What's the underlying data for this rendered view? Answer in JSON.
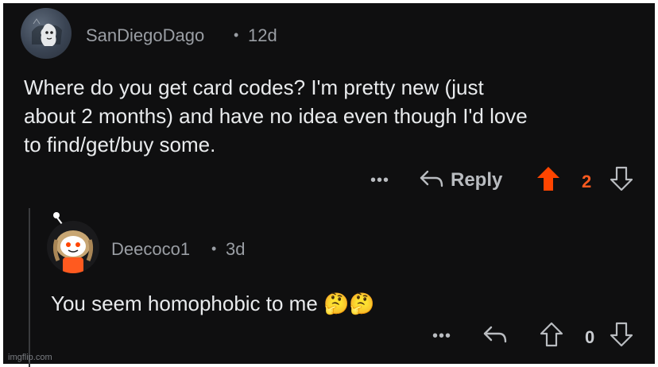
{
  "comments": [
    {
      "username": "SanDiegoDago",
      "separator": "•",
      "age": "12d",
      "text": "Where do you get card codes? I'm pretty new (just\nabout 2 months) and have no idea even though I'd love\nto find/get/buy some.",
      "actions": {
        "more": "•••",
        "reply_label": "Reply",
        "score": "2",
        "upvoted": true
      }
    },
    {
      "username": "Deecoco1",
      "separator": "•",
      "age": "3d",
      "text": "You seem homophobic to me 🤔🤔",
      "actions": {
        "more": "•••",
        "score": "0",
        "upvoted": false
      }
    }
  ],
  "watermark": "imgflip.com",
  "colors": {
    "upvote_active": "#ff4500",
    "score_active": "#ff5a1f",
    "text": "#e9ebed",
    "muted": "#9a9ea4"
  },
  "icons": [
    "avatar-ghost-icon",
    "reply-arrow-icon",
    "upvote-arrow-icon",
    "downvote-arrow-icon",
    "more-options-icon",
    "thinking-face-emoji"
  ]
}
